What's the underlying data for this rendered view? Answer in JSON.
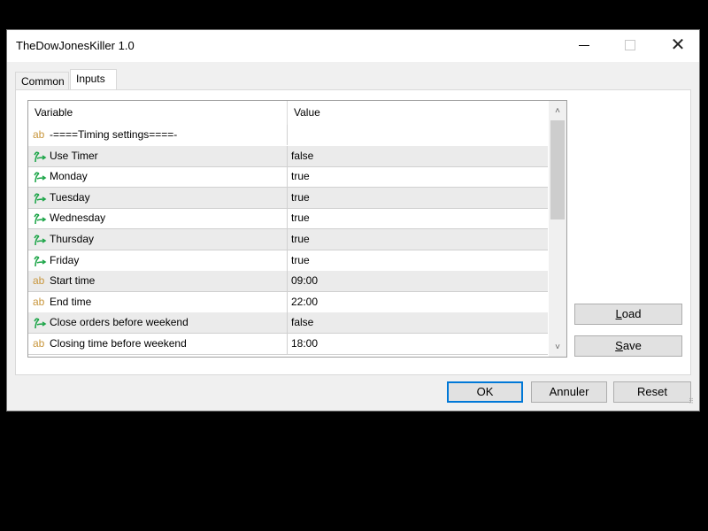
{
  "window": {
    "title": "TheDowJonesKiller 1.0",
    "controls": {
      "minimize": "minimize-icon",
      "maximize": "maximize-icon",
      "close": "close-icon"
    }
  },
  "tabs": [
    {
      "label": "Common",
      "active": false
    },
    {
      "label": "Inputs",
      "active": true
    }
  ],
  "grid": {
    "columns": [
      "Variable",
      "Value"
    ],
    "rows": [
      {
        "type": "string",
        "icon": "ab",
        "variable": "-====Timing settings====-",
        "value": ""
      },
      {
        "type": "bool",
        "icon": "bool-arrow",
        "variable": "Use Timer",
        "value": "false"
      },
      {
        "type": "bool",
        "icon": "bool-arrow",
        "variable": "Monday",
        "value": "true"
      },
      {
        "type": "bool",
        "icon": "bool-arrow",
        "variable": "Tuesday",
        "value": "true"
      },
      {
        "type": "bool",
        "icon": "bool-arrow",
        "variable": "Wednesday",
        "value": "true"
      },
      {
        "type": "bool",
        "icon": "bool-arrow",
        "variable": "Thursday",
        "value": "true"
      },
      {
        "type": "bool",
        "icon": "bool-arrow",
        "variable": "Friday",
        "value": "true"
      },
      {
        "type": "string",
        "icon": "ab",
        "variable": "Start time",
        "value": "09:00"
      },
      {
        "type": "string",
        "icon": "ab",
        "variable": "End time",
        "value": "22:00"
      },
      {
        "type": "bool",
        "icon": "bool-arrow",
        "variable": "Close orders before weekend",
        "value": "false"
      },
      {
        "type": "string",
        "icon": "ab",
        "variable": "Closing time before weekend",
        "value": "18:00"
      }
    ]
  },
  "side_buttons": {
    "load": {
      "underline": "L",
      "rest": "oad"
    },
    "save": {
      "underline": "S",
      "rest": "ave"
    }
  },
  "footer_buttons": {
    "ok": "OK",
    "cancel": "Annuler",
    "reset": "Reset"
  },
  "colors": {
    "ab_icon": "#c8963c",
    "bool_icon": "#1fa64a",
    "focus_border": "#0078d7"
  }
}
